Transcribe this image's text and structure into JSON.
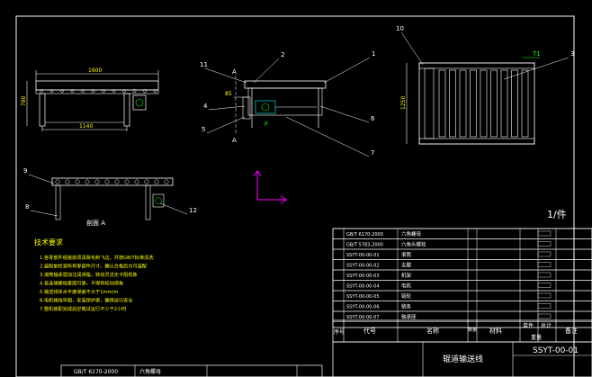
{
  "front_view": {
    "overall_length": "1600",
    "leg_span": "1140",
    "height": "780"
  },
  "side_view": {
    "section_mark": "A",
    "dim_85": "85"
  },
  "top_view": {
    "width": "1250",
    "pitch": "T1"
  },
  "callouts": [
    "1",
    "2",
    "3",
    "4",
    "5",
    "6",
    "7",
    "8",
    "9",
    "10",
    "11",
    "12"
  ],
  "section_label": "剖面 A",
  "quantity": "1/件",
  "tech_req": {
    "title": "技术要求",
    "lines": [
      "1.各零部件组装前须清除毛刺飞边，并按GB/T标准清洗",
      "2.装配前检查所有零部件尺寸，确认合格后方可装配",
      "3.滚筒轴承需加注润滑脂，转动灵活无卡阻现象",
      "4.各连接螺栓紧固可靠，不得有松动现象",
      "5.输送线体水平度误差不大于1mm/m",
      "6.电机接线牢固，安装保护罩，确保运行安全",
      "7.整机装配完成后空载试运行不少于2小时"
    ]
  },
  "parts": [
    {
      "code": "GB/T 6170-2000",
      "name": "六角螺母",
      "qty": "",
      "material": "",
      "note": ""
    },
    {
      "code": "GB/T 5783-2000",
      "name": "六角头螺栓",
      "qty": "",
      "material": "",
      "note": ""
    },
    {
      "code": "SSYT-00-00-01",
      "name": "滚筒",
      "qty": "",
      "material": "",
      "note": ""
    },
    {
      "code": "SSYT-00-00-02",
      "name": "支腿",
      "qty": "",
      "material": "",
      "note": ""
    },
    {
      "code": "SSYT-00-00-03",
      "name": "机架",
      "qty": "",
      "material": "",
      "note": ""
    },
    {
      "code": "SSYT-00-00-04",
      "name": "电机",
      "qty": "",
      "material": "",
      "note": ""
    },
    {
      "code": "SSYT-00-00-05",
      "name": "链轮",
      "qty": "",
      "material": "",
      "note": ""
    },
    {
      "code": "SSYT-00-00-06",
      "name": "链条",
      "qty": "",
      "material": "",
      "note": ""
    },
    {
      "code": "SSYT-00-00-07",
      "name": "轴承座",
      "qty": "",
      "material": "",
      "note": ""
    }
  ],
  "table_header": {
    "seq": "序号",
    "code": "代号",
    "name": "名称",
    "qty": "数量",
    "material": "材料",
    "single": "单件",
    "total": "总计",
    "weight": "重量",
    "note": "备注"
  },
  "title_block": {
    "drawing_title": "辊道输送线",
    "drawing_no": "SSYT-00-01"
  },
  "bottom_strip": {
    "code": "GB/T 6170-2000",
    "name": "六角螺母"
  }
}
